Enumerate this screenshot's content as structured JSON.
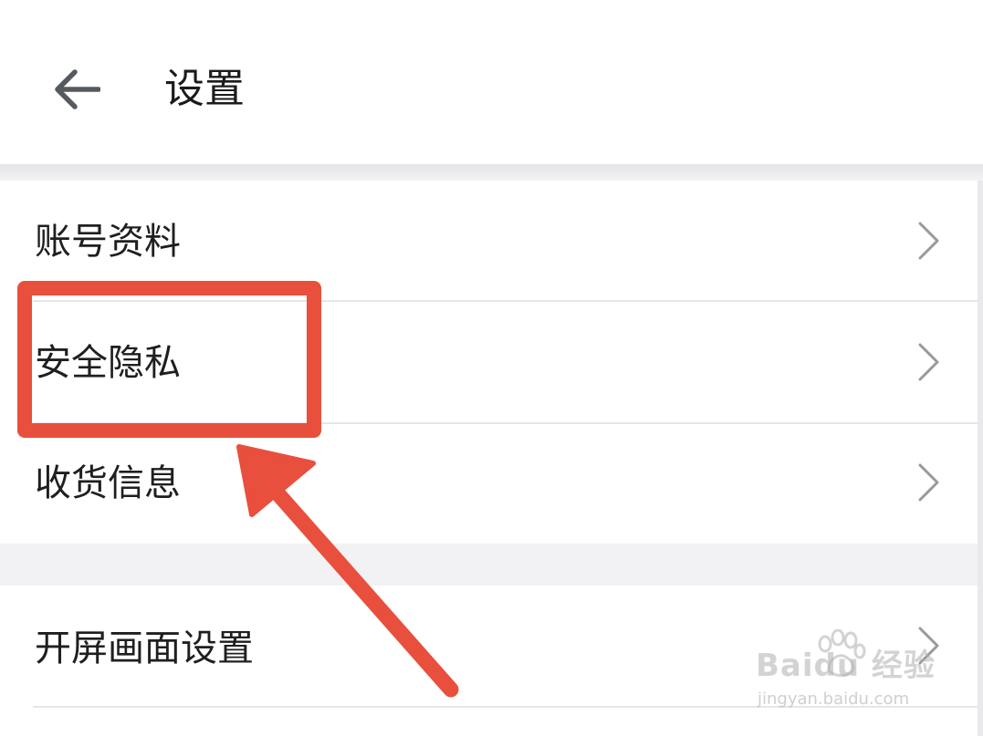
{
  "header": {
    "title": "设置",
    "back_icon": "arrow-left-icon"
  },
  "settings_groups": [
    {
      "items": [
        {
          "label": "账号资料",
          "icon": "chevron-right-icon"
        },
        {
          "label": "安全隐私",
          "icon": "chevron-right-icon"
        },
        {
          "label": "收货信息",
          "icon": "chevron-right-icon"
        }
      ]
    },
    {
      "items": [
        {
          "label": "开屏画面设置",
          "icon": "chevron-right-icon"
        }
      ]
    }
  ],
  "annotation": {
    "highlight_target": "安全隐私",
    "color": "#e94f3d"
  },
  "watermark": {
    "brand": "Baidu 经验",
    "url": "jingyan.baidu.com"
  },
  "colors": {
    "background": "#ffffff",
    "section_gap": "#f2f2f4",
    "divider": "#e6e6e8",
    "annotation_red": "#e94f3d",
    "chevron": "#9a9a9a"
  }
}
